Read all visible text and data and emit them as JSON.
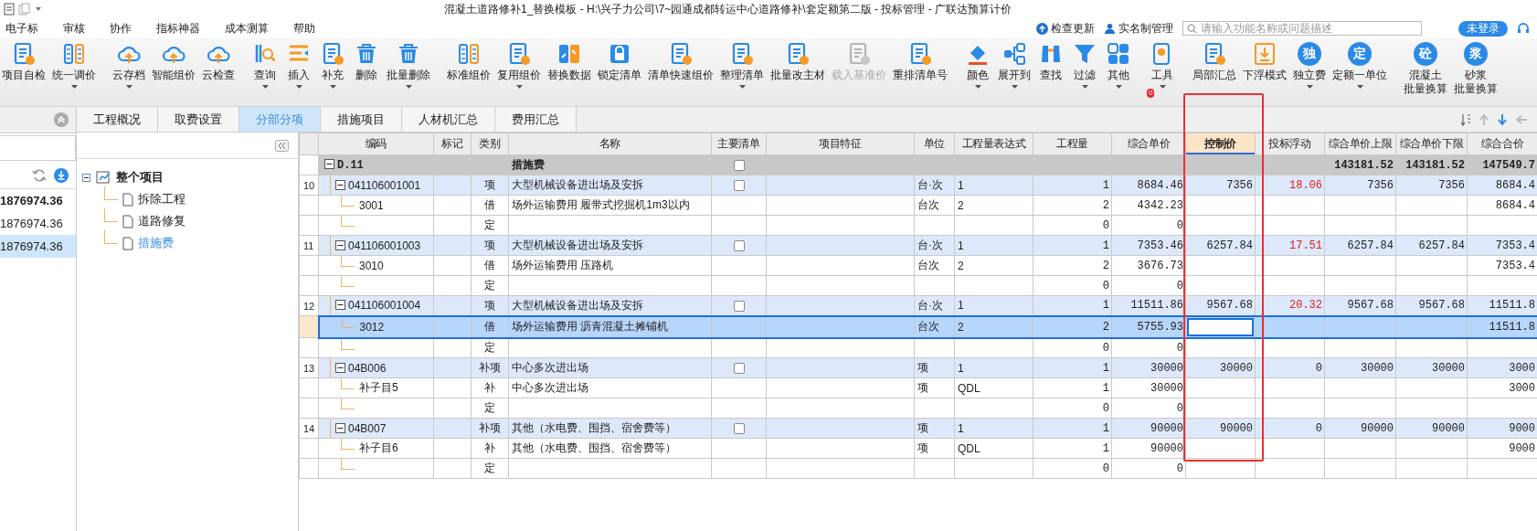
{
  "window": {
    "title": "混凝土道路修补1_替换模板 - H:\\兴子力公司\\7~园通成都转运中心道路修补\\套定额第二版 - 投标管理 - 广联达预算计价"
  },
  "menu": [
    "电子标",
    "审核",
    "协作",
    "指标神器",
    "成本测算",
    "帮助"
  ],
  "menu_actions": [
    {
      "label": "检查更新",
      "kind": "update"
    },
    {
      "label": "实名制管理",
      "kind": "user"
    }
  ],
  "search": {
    "placeholder": "请输入功能名称或问题描述"
  },
  "login_button": "未登录",
  "toolbar": {
    "groups": [
      {
        "items": [
          {
            "label": "项目自检",
            "kind": "doc",
            "dropdown": false,
            "disabled": false
          },
          {
            "label": "统一调价",
            "kind": "columns",
            "dropdown": true,
            "disabled": false
          }
        ]
      },
      {
        "items": [
          {
            "label": "云存档",
            "kind": "cloud",
            "dropdown": true,
            "disabled": false
          },
          {
            "label": "智能组价",
            "kind": "cloud",
            "dropdown": false,
            "disabled": false
          },
          {
            "label": "云检查",
            "kind": "cloud",
            "dropdown": false,
            "disabled": false
          }
        ]
      },
      {
        "items": [
          {
            "label": "查询",
            "kind": "search",
            "dropdown": true,
            "disabled": false
          },
          {
            "label": "插入",
            "kind": "list",
            "dropdown": true,
            "disabled": false
          },
          {
            "label": "补充",
            "kind": "doc",
            "dropdown": true,
            "disabled": false
          },
          {
            "label": "删除",
            "kind": "trash",
            "dropdown": false,
            "disabled": false
          },
          {
            "label": "批量删除",
            "kind": "trash",
            "dropdown": true,
            "disabled": false
          }
        ]
      },
      {
        "items": [
          {
            "label": "标准组价",
            "kind": "columns",
            "dropdown": false,
            "disabled": false
          },
          {
            "label": "复用组价",
            "kind": "doc",
            "dropdown": true,
            "disabled": false
          },
          {
            "label": "替换数据",
            "kind": "swap",
            "dropdown": false,
            "disabled": false
          },
          {
            "label": "锁定清单",
            "kind": "lock",
            "dropdown": false,
            "disabled": false
          },
          {
            "label": "清单快速组价",
            "kind": "doc",
            "dropdown": false,
            "disabled": false
          },
          {
            "label": "整理清单",
            "kind": "doc",
            "dropdown": true,
            "disabled": false
          },
          {
            "label": "批量改主材",
            "kind": "doc",
            "dropdown": false,
            "disabled": false
          },
          {
            "label": "载入基准价",
            "kind": "doc",
            "dropdown": false,
            "disabled": true
          },
          {
            "label": "重排清单号",
            "kind": "doc",
            "dropdown": false,
            "disabled": false
          }
        ]
      },
      {
        "items": [
          {
            "label": "颜色",
            "kind": "bucket",
            "dropdown": true,
            "disabled": false
          },
          {
            "label": "展开到",
            "kind": "nodes",
            "dropdown": true,
            "disabled": false
          },
          {
            "label": "查找",
            "kind": "binoculars",
            "dropdown": false,
            "disabled": false
          },
          {
            "label": "过滤",
            "kind": "filter",
            "dropdown": true,
            "disabled": false
          },
          {
            "label": "其他",
            "kind": "grid",
            "dropdown": true,
            "disabled": false
          }
        ]
      },
      {
        "items": [
          {
            "label": "工具",
            "kind": "tool",
            "dropdown": true,
            "disabled": false,
            "badge": "0"
          }
        ]
      },
      {
        "items": [
          {
            "label": "局部汇总",
            "kind": "doc",
            "dropdown": false,
            "disabled": false
          },
          {
            "label": "下浮模式",
            "kind": "download",
            "dropdown": false,
            "disabled": false
          },
          {
            "label": "独立费",
            "kind": "glyph",
            "glyph": "独",
            "dropdown": true,
            "disabled": false
          },
          {
            "label": "定额一单位",
            "kind": "glyph",
            "glyph": "定",
            "dropdown": true,
            "disabled": false
          }
        ]
      },
      {
        "items": [
          {
            "label_lines": [
              "混凝土",
              "批量换算"
            ],
            "kind": "glyph",
            "glyph": "砼",
            "dropdown": false,
            "disabled": false
          },
          {
            "label_lines": [
              "砂浆",
              "批量换算"
            ],
            "kind": "glyph",
            "glyph": "浆",
            "dropdown": false,
            "disabled": false
          }
        ]
      }
    ]
  },
  "tabs": [
    {
      "label": "工程概况",
      "selected": false
    },
    {
      "label": "取费设置",
      "selected": false
    },
    {
      "label": "分部分项",
      "selected": true
    },
    {
      "label": "措施项目",
      "selected": false
    },
    {
      "label": "人材机汇总",
      "selected": false
    },
    {
      "label": "费用汇总",
      "selected": false
    }
  ],
  "left_panel": {
    "amounts": [
      {
        "value": "1876974.36",
        "kind": "total",
        "selected": false
      },
      {
        "value": "1876974.36",
        "kind": "part",
        "selected": false
      },
      {
        "value": "1876974.36",
        "kind": "part",
        "selected": true
      }
    ]
  },
  "tree": {
    "items": [
      {
        "label": "整个项目",
        "expanded": true,
        "selected": false,
        "children": [
          {
            "label": "拆除工程",
            "selected": false
          },
          {
            "label": "道路修复",
            "selected": false
          },
          {
            "label": "措施费",
            "selected": true
          }
        ]
      }
    ]
  },
  "table": {
    "columns": [
      {
        "label": "编码",
        "highlighted": false
      },
      {
        "label": "标记",
        "highlighted": false
      },
      {
        "label": "类别",
        "highlighted": false
      },
      {
        "label": "名称",
        "highlighted": false
      },
      {
        "label": "主要清单",
        "highlighted": false
      },
      {
        "label": "项目特征",
        "highlighted": false
      },
      {
        "label": "单位",
        "highlighted": false
      },
      {
        "label": "工程量表达式",
        "highlighted": false
      },
      {
        "label": "工程量",
        "highlighted": false
      },
      {
        "label": "综合单价",
        "highlighted": false
      },
      {
        "label": "控制价",
        "highlighted": true
      },
      {
        "label": "投标浮动",
        "highlighted": false
      },
      {
        "label": "综合单价上限",
        "highlighted": false
      },
      {
        "label": "综合单价下限",
        "highlighted": false
      },
      {
        "label": "综合合价",
        "highlighted": false
      }
    ],
    "rows": [
      {
        "kind": "section",
        "selected": false,
        "editing": false,
        "expanded": true,
        "code": "D.11",
        "name": "措施费",
        "main_list": false,
        "price_upper": "143181.52",
        "price_lower": "143181.52",
        "total": "147549.7"
      },
      {
        "kind": "item",
        "selected": false,
        "editing": false,
        "num": "10",
        "expanded": true,
        "code": "041106001001",
        "type": "项",
        "name": "大型机械设备进出场及安拆",
        "main_list": false,
        "unit": "台·次",
        "expression": "1",
        "quantity": "1",
        "unit_price": "8684.46",
        "control_price": "7356",
        "bid_float": "18.06",
        "over_limit": true,
        "price_upper": "7356",
        "price_lower": "7356",
        "total": "8684.4"
      },
      {
        "kind": "sub",
        "selected": false,
        "editing": false,
        "code": "3001",
        "type": "借",
        "name": "场外运输费用 履带式挖掘机1m3以内",
        "unit": "台次",
        "expression": "2",
        "quantity": "2",
        "unit_price": "4342.23",
        "total": "8684.4"
      },
      {
        "kind": "sub",
        "selected": false,
        "editing": false,
        "type": "定",
        "quantity": "0",
        "unit_price": "0"
      },
      {
        "kind": "item",
        "selected": false,
        "editing": false,
        "num": "11",
        "expanded": true,
        "code": "041106001003",
        "type": "项",
        "name": "大型机械设备进出场及安拆",
        "main_list": false,
        "unit": "台·次",
        "expression": "1",
        "quantity": "1",
        "unit_price": "7353.46",
        "control_price": "6257.84",
        "bid_float": "17.51",
        "over_limit": true,
        "price_upper": "6257.84",
        "price_lower": "6257.84",
        "total": "7353.4"
      },
      {
        "kind": "sub",
        "selected": false,
        "editing": false,
        "code": "3010",
        "type": "借",
        "name": "场外运输费用 压路机",
        "unit": "台次",
        "expression": "2",
        "quantity": "2",
        "unit_price": "3676.73",
        "total": "7353.4"
      },
      {
        "kind": "sub",
        "selected": false,
        "editing": false,
        "type": "定",
        "quantity": "0",
        "unit_price": "0"
      },
      {
        "kind": "item",
        "selected": false,
        "editing": false,
        "num": "12",
        "expanded": true,
        "code": "041106001004",
        "type": "项",
        "name": "大型机械设备进出场及安拆",
        "main_list": false,
        "unit": "台·次",
        "expression": "1",
        "quantity": "1",
        "unit_price": "11511.86",
        "control_price": "9567.68",
        "bid_float": "20.32",
        "over_limit": true,
        "price_upper": "9567.68",
        "price_lower": "9567.68",
        "total": "11511.8"
      },
      {
        "kind": "sub",
        "selected": true,
        "editing": true,
        "code": "3012",
        "type": "借",
        "name": "场外运输费用 沥青混凝土摊铺机",
        "unit": "台次",
        "expression": "2",
        "quantity": "2",
        "unit_price": "5755.93",
        "total": "11511.8"
      },
      {
        "kind": "sub",
        "selected": false,
        "editing": false,
        "type": "定",
        "quantity": "0",
        "unit_price": "0"
      },
      {
        "kind": "item",
        "selected": false,
        "editing": false,
        "num": "13",
        "expanded": true,
        "code": "04B006",
        "type": "补项",
        "name": "中心多次进出场",
        "main_list": false,
        "unit": "项",
        "expression": "1",
        "quantity": "1",
        "unit_price": "30000",
        "control_price": "30000",
        "bid_float": "0",
        "over_limit": false,
        "price_upper": "30000",
        "price_lower": "30000",
        "total": "3000"
      },
      {
        "kind": "sub",
        "selected": false,
        "editing": false,
        "code": "补子目5",
        "type": "补",
        "name": "中心多次进出场",
        "unit": "项",
        "expression": "QDL",
        "quantity": "1",
        "unit_price": "30000",
        "total": "3000"
      },
      {
        "kind": "sub",
        "selected": false,
        "editing": false,
        "type": "定",
        "quantity": "0",
        "unit_price": "0"
      },
      {
        "kind": "item",
        "selected": false,
        "editing": false,
        "num": "14",
        "expanded": true,
        "code": "04B007",
        "type": "补项",
        "name": "其他（水电费、围挡、宿舍费等）",
        "main_list": false,
        "unit": "项",
        "expression": "1",
        "quantity": "1",
        "unit_price": "90000",
        "control_price": "90000",
        "bid_float": "0",
        "over_limit": false,
        "price_upper": "90000",
        "price_lower": "90000",
        "total": "9000"
      },
      {
        "kind": "sub",
        "selected": false,
        "editing": false,
        "code": "补子目6",
        "type": "补",
        "name": "其他（水电费、围挡、宿舍费等）",
        "unit": "项",
        "expression": "QDL",
        "quantity": "1",
        "unit_price": "90000",
        "total": "9000"
      },
      {
        "kind": "sub",
        "selected": false,
        "editing": false,
        "type": "定",
        "quantity": "0",
        "unit_price": "0"
      }
    ]
  }
}
